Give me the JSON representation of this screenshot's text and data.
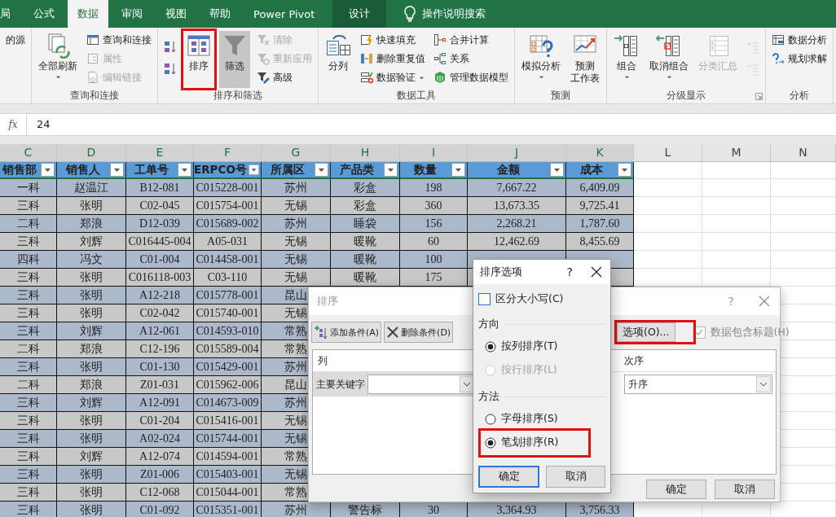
{
  "tabs": [
    {
      "label": "局",
      "selected": false,
      "kind": "normal"
    },
    {
      "label": "公式",
      "selected": false,
      "kind": "normal"
    },
    {
      "label": "数据",
      "selected": true,
      "kind": "normal"
    },
    {
      "label": "审阅",
      "selected": false,
      "kind": "normal"
    },
    {
      "label": "视图",
      "selected": false,
      "kind": "normal"
    },
    {
      "label": "帮助",
      "selected": false,
      "kind": "normal"
    },
    {
      "label": "Power Pivot",
      "selected": false,
      "kind": "normal"
    },
    {
      "label": "设计",
      "selected": false,
      "kind": "context"
    }
  ],
  "tell_me": {
    "label": "操作说明搜索"
  },
  "ribbon_groups": [
    {
      "launcher": false,
      "columns": [
        {
          "kind": "stack",
          "items": [
            {
              "kind": "text",
              "label": "的源",
              "disabled": false,
              "pressed": false,
              "highlighted": false
            }
          ]
        }
      ]
    },
    {
      "label": "查询和连接",
      "launcher": false,
      "columns": [
        {
          "kind": "big",
          "items": [
            {
              "kind": "big",
              "label": "全部刷新",
              "dropdown": true,
              "disabled": false,
              "pressed": false,
              "highlighted": false
            }
          ]
        },
        {
          "kind": "stack",
          "items": [
            {
              "kind": "small",
              "label": "查询和连接",
              "disabled": false,
              "pressed": false,
              "highlighted": false
            },
            {
              "kind": "small",
              "label": "属性",
              "disabled": true,
              "pressed": false,
              "highlighted": false
            },
            {
              "kind": "small",
              "label": "编辑链接",
              "disabled": true,
              "pressed": false,
              "highlighted": false
            }
          ]
        }
      ]
    },
    {
      "label": "排序和筛选",
      "launcher": false,
      "columns": [
        {
          "kind": "pair",
          "items": [
            {
              "kind": "icon",
              "disabled": false,
              "pressed": false,
              "highlighted": false
            },
            {
              "kind": "icon",
              "disabled": false,
              "pressed": false,
              "highlighted": false
            }
          ]
        },
        {
          "kind": "big",
          "items": [
            {
              "kind": "big",
              "label": "排序",
              "disabled": false,
              "pressed": false,
              "highlighted": true
            }
          ]
        },
        {
          "kind": "big",
          "items": [
            {
              "kind": "big",
              "label": "筛选",
              "disabled": false,
              "pressed": true,
              "highlighted": false
            }
          ]
        },
        {
          "kind": "stack",
          "items": [
            {
              "kind": "small",
              "label": "清除",
              "disabled": true,
              "pressed": false,
              "highlighted": false
            },
            {
              "kind": "small",
              "label": "重新应用",
              "disabled": true,
              "pressed": false,
              "highlighted": false
            },
            {
              "kind": "small",
              "label": "高级",
              "disabled": false,
              "pressed": false,
              "highlighted": false
            }
          ]
        }
      ]
    },
    {
      "label": "数据工具",
      "launcher": false,
      "columns": [
        {
          "kind": "big",
          "items": [
            {
              "kind": "big",
              "label": "分列",
              "disabled": false,
              "pressed": false,
              "highlighted": false
            }
          ]
        },
        {
          "kind": "stack",
          "items": [
            {
              "kind": "small",
              "label": "快速填充",
              "disabled": false,
              "pressed": false,
              "highlighted": false
            },
            {
              "kind": "small",
              "label": "删除重复值",
              "disabled": false,
              "pressed": false,
              "highlighted": false
            },
            {
              "kind": "small",
              "label": "数据验证",
              "dropdown": true,
              "disabled": false,
              "pressed": false,
              "highlighted": false
            }
          ]
        },
        {
          "kind": "stack",
          "items": [
            {
              "kind": "small",
              "label": "合并计算",
              "disabled": false,
              "pressed": false,
              "highlighted": false
            },
            {
              "kind": "small",
              "label": "关系",
              "disabled": false,
              "pressed": false,
              "highlighted": false
            },
            {
              "kind": "small",
              "label": "管理数据模型",
              "disabled": false,
              "pressed": false,
              "highlighted": false
            }
          ]
        }
      ]
    },
    {
      "label": "预测",
      "launcher": false,
      "columns": [
        {
          "kind": "big",
          "items": [
            {
              "kind": "big",
              "label": "模拟分析",
              "dropdown": true,
              "disabled": false,
              "pressed": false,
              "highlighted": false
            }
          ]
        },
        {
          "kind": "big",
          "items": [
            {
              "kind": "big",
              "label_lines": [
                "预测",
                "工作表"
              ],
              "disabled": false,
              "pressed": false,
              "highlighted": false
            }
          ]
        }
      ]
    },
    {
      "label": "分级显示",
      "launcher": true,
      "columns": [
        {
          "kind": "big",
          "items": [
            {
              "kind": "big",
              "label": "组合",
              "dropdown": true,
              "disabled": false,
              "pressed": false,
              "highlighted": false
            }
          ]
        },
        {
          "kind": "big",
          "items": [
            {
              "kind": "big",
              "label": "取消组合",
              "dropdown": true,
              "disabled": false,
              "pressed": false,
              "highlighted": false
            }
          ]
        },
        {
          "kind": "big",
          "items": [
            {
              "kind": "big",
              "label": "分类汇总",
              "disabled": true,
              "pressed": false,
              "highlighted": false
            }
          ]
        },
        {
          "kind": "pair",
          "items": [
            {
              "kind": "icon",
              "disabled": true,
              "pressed": false,
              "highlighted": false
            },
            {
              "kind": "icon",
              "disabled": true,
              "pressed": false,
              "highlighted": false
            }
          ]
        }
      ]
    },
    {
      "label": "分析",
      "launcher": false,
      "columns": [
        {
          "kind": "stack",
          "items": [
            {
              "kind": "small",
              "label": "数据分析",
              "disabled": false,
              "pressed": false,
              "highlighted": false
            },
            {
              "kind": "small",
              "label": "规划求解",
              "disabled": false,
              "pressed": false,
              "highlighted": false
            }
          ]
        }
      ]
    }
  ],
  "formula_bar": {
    "function_label": "fx",
    "value": "24"
  },
  "columns": [
    {
      "letter": "C",
      "selected": true
    },
    {
      "letter": "D",
      "selected": true
    },
    {
      "letter": "E",
      "selected": true
    },
    {
      "letter": "F",
      "selected": true
    },
    {
      "letter": "G",
      "selected": true
    },
    {
      "letter": "H",
      "selected": true
    },
    {
      "letter": "I",
      "selected": true
    },
    {
      "letter": "J",
      "selected": true
    },
    {
      "letter": "K",
      "selected": true
    },
    {
      "letter": "L",
      "selected": false
    },
    {
      "letter": "M",
      "selected": false
    },
    {
      "letter": "N",
      "selected": false
    }
  ],
  "table": {
    "headers": [
      "销售部",
      "销售人",
      "工单号",
      "ERPCO号",
      "所属区",
      "产品类",
      "数量",
      "金额",
      "成本"
    ],
    "rows": [
      {
        "cells": [
          "一科",
          "赵温江",
          "B12-081",
          "C015228-001",
          "苏州",
          "彩盒",
          "198",
          "7,667.22",
          "6,409.09"
        ]
      },
      {
        "cells": [
          "三科",
          "张明",
          "C02-045",
          "C015754-001",
          "无锡",
          "彩盒",
          "360",
          "13,673.35",
          "9,725.41"
        ]
      },
      {
        "cells": [
          "二科",
          "郑浪",
          "D12-039",
          "C015689-002",
          "苏州",
          "睡袋",
          "156",
          "2,268.21",
          "1,787.60"
        ]
      },
      {
        "cells": [
          "三科",
          "刘辉",
          "C016445-004",
          "A05-031",
          "无锡",
          "暖靴",
          "60",
          "12,462.69",
          "8,455.69"
        ]
      },
      {
        "cells": [
          "四科",
          "冯文",
          "C01-004",
          "C014458-001",
          "无锡",
          "暖靴",
          "100"
        ]
      },
      {
        "cells": [
          "三科",
          "张明",
          "C016118-003",
          "C03-110",
          "无锡",
          "暖靴",
          "175"
        ]
      },
      {
        "cells": [
          "三科",
          "张明",
          "A12-218",
          "C015778-001",
          "昆山"
        ]
      },
      {
        "cells": [
          "三科",
          "张明",
          "C02-042",
          "C015740-001",
          "无锡"
        ]
      },
      {
        "cells": [
          "三科",
          "刘辉",
          "A12-061",
          "C014593-010",
          "常熟"
        ]
      },
      {
        "cells": [
          "二科",
          "郑浪",
          "C12-196",
          "C015589-004",
          "常熟"
        ]
      },
      {
        "cells": [
          "三科",
          "张明",
          "C01-130",
          "C015429-001",
          "苏州"
        ]
      },
      {
        "cells": [
          "二科",
          "郑浪",
          "Z01-031",
          "C015962-006",
          "昆山"
        ]
      },
      {
        "cells": [
          "三科",
          "刘辉",
          "A12-091",
          "C014673-009",
          "苏州"
        ]
      },
      {
        "cells": [
          "三科",
          "张明",
          "C01-204",
          "C015416-001",
          "无锡"
        ]
      },
      {
        "cells": [
          "三科",
          "张明",
          "A02-024",
          "C015744-001",
          "无锡"
        ]
      },
      {
        "cells": [
          "三科",
          "刘辉",
          "A12-074",
          "C014594-001",
          "常熟"
        ]
      },
      {
        "cells": [
          "三科",
          "张明",
          "Z01-006",
          "C015403-001",
          "无锡"
        ]
      },
      {
        "cells": [
          "三科",
          "张明",
          "C12-068",
          "C015044-001",
          "常熟"
        ]
      },
      {
        "cells": [
          "三科",
          "张明",
          "C01-092",
          "C015351-001",
          "苏州",
          "警告标",
          "30",
          "3,364.93",
          "3,756.33"
        ]
      }
    ]
  },
  "sort_dialog": {
    "title": "排序",
    "help": "?",
    "toolbar": [
      {
        "kind": "add",
        "label": "添加条件(A)"
      },
      {
        "kind": "delete",
        "label": "删除条件(D)"
      }
    ],
    "options_button": {
      "label": "选项(O)...",
      "highlighted": true
    },
    "header_checkbox": {
      "label": "数据包含标题(H)",
      "checked": true,
      "disabled": true
    },
    "list": {
      "column_heading": "列",
      "order_heading": "次序",
      "rows": [
        {
          "label": "主要关键字",
          "order_value": "升序"
        }
      ]
    },
    "buttons": [
      "确定",
      "取消"
    ]
  },
  "options_dialog": {
    "title": "排序选项",
    "help": "?",
    "case_checkbox": {
      "label": "区分大小写(C)",
      "checked": false
    },
    "sections": [
      {
        "title": "方向",
        "options": [
          {
            "label": "按列排序(T)",
            "selected": true,
            "disabled": false,
            "highlighted": false
          },
          {
            "label": "按行排序(L)",
            "selected": false,
            "disabled": true,
            "highlighted": false
          }
        ]
      },
      {
        "title": "方法",
        "options": [
          {
            "label": "字母排序(S)",
            "selected": false,
            "disabled": false,
            "highlighted": false
          },
          {
            "label": "笔划排序(R)",
            "selected": true,
            "disabled": false,
            "highlighted": true
          }
        ]
      }
    ],
    "buttons": [
      {
        "label": "确定",
        "default": true
      },
      {
        "label": "取消",
        "default": false
      }
    ]
  }
}
